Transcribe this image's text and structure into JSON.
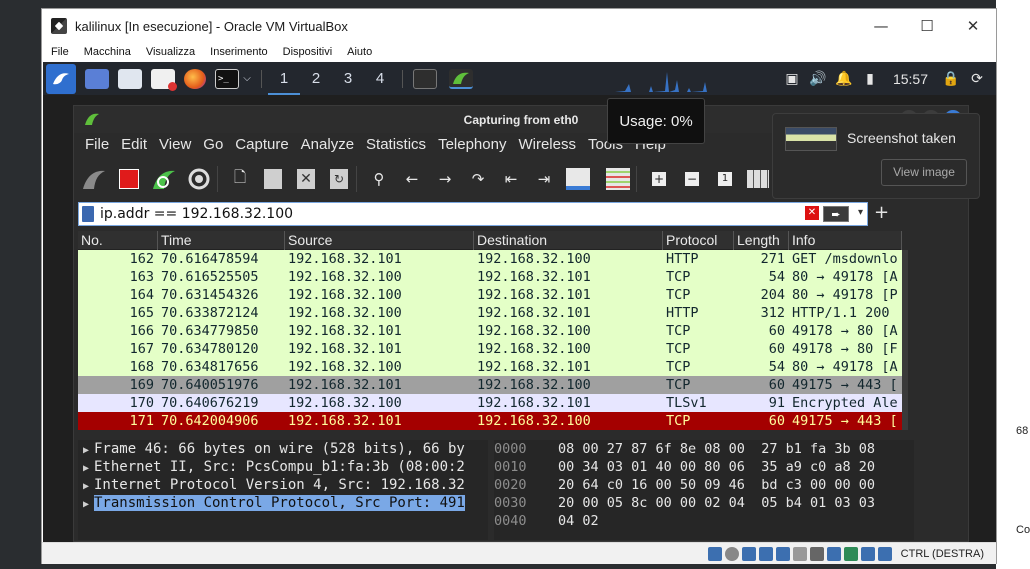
{
  "vbox": {
    "title": "kalilinux [In esecuzione] - Oracle VM VirtualBox",
    "menu": [
      "File",
      "Macchina",
      "Visualizza",
      "Inserimento",
      "Dispositivi",
      "Aiuto"
    ],
    "status_text": "CTRL (DESTRA)",
    "ctrl_min": "—",
    "ctrl_max": "☐",
    "ctrl_close": "✕"
  },
  "desktop": {
    "right_texts": [
      "68",
      "Co"
    ]
  },
  "kali_panel": {
    "workspaces": [
      "1",
      "2",
      "3",
      "4"
    ],
    "clock": "15:57",
    "terminal_label": ">_"
  },
  "wireshark": {
    "title": "Capturing from eth0",
    "menu": [
      "File",
      "Edit",
      "View",
      "Go",
      "Capture",
      "Analyze",
      "Statistics",
      "Telephony",
      "Wireless",
      "Tools",
      "Help"
    ],
    "filter_value": "ip.addr == 192.168.32.100",
    "columns": [
      "No.",
      "Time",
      "Source",
      "Destination",
      "Protocol",
      "Length",
      "Info"
    ],
    "packets": [
      {
        "no": "162",
        "time": "70.616478594",
        "src": "192.168.32.101",
        "dst": "192.168.32.100",
        "proto": "HTTP",
        "len": "271",
        "info": "GET /msdownlo",
        "style": "green"
      },
      {
        "no": "163",
        "time": "70.616525505",
        "src": "192.168.32.100",
        "dst": "192.168.32.101",
        "proto": "TCP",
        "len": "54",
        "info": "80 → 49178 [A",
        "style": "green"
      },
      {
        "no": "164",
        "time": "70.631454326",
        "src": "192.168.32.100",
        "dst": "192.168.32.101",
        "proto": "TCP",
        "len": "204",
        "info": "80 → 49178 [P",
        "style": "green"
      },
      {
        "no": "165",
        "time": "70.633872124",
        "src": "192.168.32.100",
        "dst": "192.168.32.101",
        "proto": "HTTP",
        "len": "312",
        "info": "HTTP/1.1 200",
        "style": "green"
      },
      {
        "no": "166",
        "time": "70.634779850",
        "src": "192.168.32.101",
        "dst": "192.168.32.100",
        "proto": "TCP",
        "len": "60",
        "info": "49178 → 80 [A",
        "style": "green"
      },
      {
        "no": "167",
        "time": "70.634780120",
        "src": "192.168.32.101",
        "dst": "192.168.32.100",
        "proto": "TCP",
        "len": "60",
        "info": "49178 → 80 [F",
        "style": "green"
      },
      {
        "no": "168",
        "time": "70.634817656",
        "src": "192.168.32.100",
        "dst": "192.168.32.101",
        "proto": "TCP",
        "len": "54",
        "info": "80 → 49178 [A",
        "style": "green"
      },
      {
        "no": "169",
        "time": "70.640051976",
        "src": "192.168.32.101",
        "dst": "192.168.32.100",
        "proto": "TCP",
        "len": "60",
        "info": "49175 → 443 [",
        "style": "gray"
      },
      {
        "no": "170",
        "time": "70.640676219",
        "src": "192.168.32.100",
        "dst": "192.168.32.101",
        "proto": "TLSv1",
        "len": "91",
        "info": "Encrypted Ale",
        "style": "lavender"
      },
      {
        "no": "171",
        "time": "70.642004906",
        "src": "192.168.32.101",
        "dst": "192.168.32.100",
        "proto": "TCP",
        "len": "60",
        "info": "49175 → 443 [",
        "style": "red"
      }
    ],
    "details": [
      "Frame 46: 66 bytes on wire (528 bits), 66 by",
      "Ethernet II, Src: PcsCompu_b1:fa:3b (08:00:2",
      "Internet Protocol Version 4, Src: 192.168.32",
      "Transmission Control Protocol, Src Port: 491"
    ],
    "hex": [
      {
        "offset": "0000",
        "bytes": "08 00 27 87 6f 8e 08 00  27 b1 fa 3b 08"
      },
      {
        "offset": "0010",
        "bytes": "00 34 03 01 40 00 80 06  35 a9 c0 a8 20"
      },
      {
        "offset": "0020",
        "bytes": "20 64 c0 16 00 50 09 46  bd c3 00 00 00"
      },
      {
        "offset": "0030",
        "bytes": "20 00 05 8c 00 00 02 04  05 b4 01 03 03"
      },
      {
        "offset": "0040",
        "bytes": "04 02"
      }
    ],
    "usage_tooltip": "Usage: 0%"
  },
  "toast": {
    "title": "Screenshot taken",
    "button": "View image"
  },
  "colors": {
    "green_row": "#e4ffc7",
    "gray_row": "#a0a0a0",
    "lavender_row": "#e7e6ff",
    "red_row": "#a40000",
    "red_row_text": "#fffc9c",
    "accent": "#4c8fd6"
  }
}
